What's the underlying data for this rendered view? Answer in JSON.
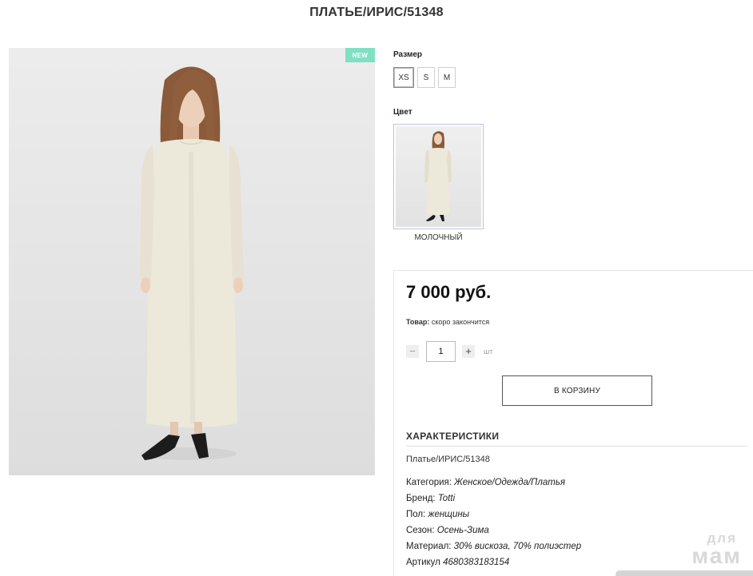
{
  "product": {
    "title": "ПЛАТЬЕ/ИРИС/51348",
    "badge": "NEW",
    "image_alt": "model-in-long-milky-dress"
  },
  "size": {
    "label": "Размер",
    "options": [
      "XS",
      "S",
      "M"
    ],
    "selected": "XS"
  },
  "color": {
    "label": "Цвет",
    "selected_name": "МОЛОЧНЫЙ"
  },
  "buy": {
    "price": "7 000 руб.",
    "stock_label": "Товар:",
    "stock_value": "скоро закончится",
    "qty_minus": "−",
    "qty_value": "1",
    "qty_plus": "+",
    "qty_unit": "шт",
    "cart_button": "В КОРЗИНУ"
  },
  "specs": {
    "title": "ХАРАКТЕРИСТИКИ",
    "sku_line": "Платье/ИРИС/51348",
    "rows": [
      {
        "key": "Категория:",
        "value": "Женское/Одежда/Платья"
      },
      {
        "key": "Бренд:",
        "value": "Totti"
      },
      {
        "key": "Пол:",
        "value": "женщины"
      },
      {
        "key": "Сезон:",
        "value": "Осень-Зима"
      },
      {
        "key": "Материал:",
        "value": "30% вискоза, 70% полиэстер"
      },
      {
        "key": "Артикул",
        "value": "4680383183154"
      }
    ]
  },
  "watermark": {
    "small": "для",
    "big": "мам"
  },
  "colors": {
    "badge": "#7fe0c4",
    "dress": "#ece8da",
    "hair": "#8a5a3a"
  }
}
